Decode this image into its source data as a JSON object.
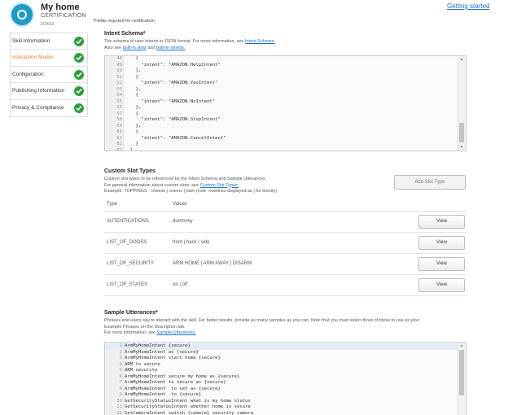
{
  "header": {
    "skill_name": "My home",
    "skill_type": "CERTIFICATION",
    "date": "5/24/16",
    "required_note": "*Fields required for certification",
    "getting_started": "Getting started"
  },
  "sidebar": {
    "items": [
      {
        "label": "Skill Information",
        "active": false
      },
      {
        "label": "Interaction Model",
        "active": true
      },
      {
        "label": "Configuration",
        "active": false
      },
      {
        "label": "Publishing Information",
        "active": false
      },
      {
        "label": "Privacy & Compliance",
        "active": false
      }
    ]
  },
  "intent_schema": {
    "title": "Intent Schema*",
    "desc_line1_prefix": "The schema of user intents in JSON format. For more information, see ",
    "desc_line1_link": "Intent Schema.",
    "desc_line2_prefix": "Also see ",
    "desc_line2_link1": "built-in slots",
    "desc_line2_mid": " and ",
    "desc_line2_link2": "built-in intents.",
    "lines": [
      {
        "n": "48",
        "t": "    {"
      },
      {
        "n": "49",
        "t": "      \"intent\": \"AMAZON.HelpIntent\""
      },
      {
        "n": "50",
        "t": "    },"
      },
      {
        "n": "51",
        "t": "    {"
      },
      {
        "n": "52",
        "t": "      \"intent\": \"AMAZON.YesIntent\""
      },
      {
        "n": "53",
        "t": "    },"
      },
      {
        "n": "54",
        "t": "    {"
      },
      {
        "n": "55",
        "t": "      \"intent\": \"AMAZON.NoIntent\""
      },
      {
        "n": "56",
        "t": "    },"
      },
      {
        "n": "57",
        "t": "    {"
      },
      {
        "n": "58",
        "t": "      \"intent\": \"AMAZON.StopIntent\""
      },
      {
        "n": "59",
        "t": "    },"
      },
      {
        "n": "60",
        "t": "    {"
      },
      {
        "n": "61",
        "t": "      \"intent\": \"AMAZON.CancelIntent\""
      },
      {
        "n": "62",
        "t": "    }"
      },
      {
        "n": "63",
        "t": "  ]"
      },
      {
        "n": "64",
        "t": "}"
      }
    ]
  },
  "custom_slots": {
    "title": "Custom Slot Types",
    "desc1": "Custom slot types to be referenced by the Intent Schema and Sample Utterances",
    "desc2_prefix": "For general information about custom slots, see ",
    "desc2_link": "Custom Slot Types.",
    "desc3": "Example: TOPPINGS - cheese | onions | ham (note: newlines displayed as | for brevity)",
    "add_button": "Add Slot Type",
    "col_type": "Type",
    "col_values": "Values",
    "view_label": "View",
    "rows": [
      {
        "type": "AUTENTICATIONS",
        "values": "dummmy"
      },
      {
        "type": "LIST_OF_DOORS",
        "values": "front | back | side"
      },
      {
        "type": "LIST_OF_SECURITY",
        "values": "ARM HOME | ARM AWAY | DISARM"
      },
      {
        "type": "LIST_OF_STATES",
        "values": "on | off"
      }
    ]
  },
  "utterances": {
    "title": "Sample Utterances*",
    "desc1": "Phrases end users say to interact with the skill. For better results, provide as many samples as you can. Note that you must select three of these to use as your",
    "desc2": "Example Phrases on the Description tab.",
    "desc3_prefix": "For more information, see ",
    "desc3_link": "Sample Utterances.",
    "lines": [
      {
        "n": "1",
        "t": "ArmMyHomeIntent {secure}"
      },
      {
        "n": "2",
        "t": "ArmMyHomeIntent as {secure}"
      },
      {
        "n": "3",
        "t": "ArmMyHomeIntent start home {secure}"
      },
      {
        "n": "4",
        "t": "ARM to secure"
      },
      {
        "n": "5",
        "t": "ARM security"
      },
      {
        "n": "6",
        "t": "ArmMyHomeIntent secure my home as {secure}"
      },
      {
        "n": "7",
        "t": "ArmMyHomeIntent to secure as {secure}"
      },
      {
        "n": "8",
        "t": "ArmMyHomeIntent  to set as {secure}"
      },
      {
        "n": "9",
        "t": "ArmMyHomeIntent  to {secure}"
      },
      {
        "n": "10",
        "t": "GetSecurityStatusIntent what is my home status"
      },
      {
        "n": "11",
        "t": "GetSecurityStatusIntent whether home is secure"
      },
      {
        "n": "12",
        "t": "SetCameraIntent switch {camera} security camera"
      },
      {
        "n": "13",
        "t": "SetCameraIntent to switch {camera}  security camera"
      }
    ]
  },
  "colors": {
    "accent_link": "#1a6ec7",
    "active_nav": "#e07b2c",
    "check_green": "#2e9e3e",
    "logo_blue": "#1e9bc6"
  }
}
